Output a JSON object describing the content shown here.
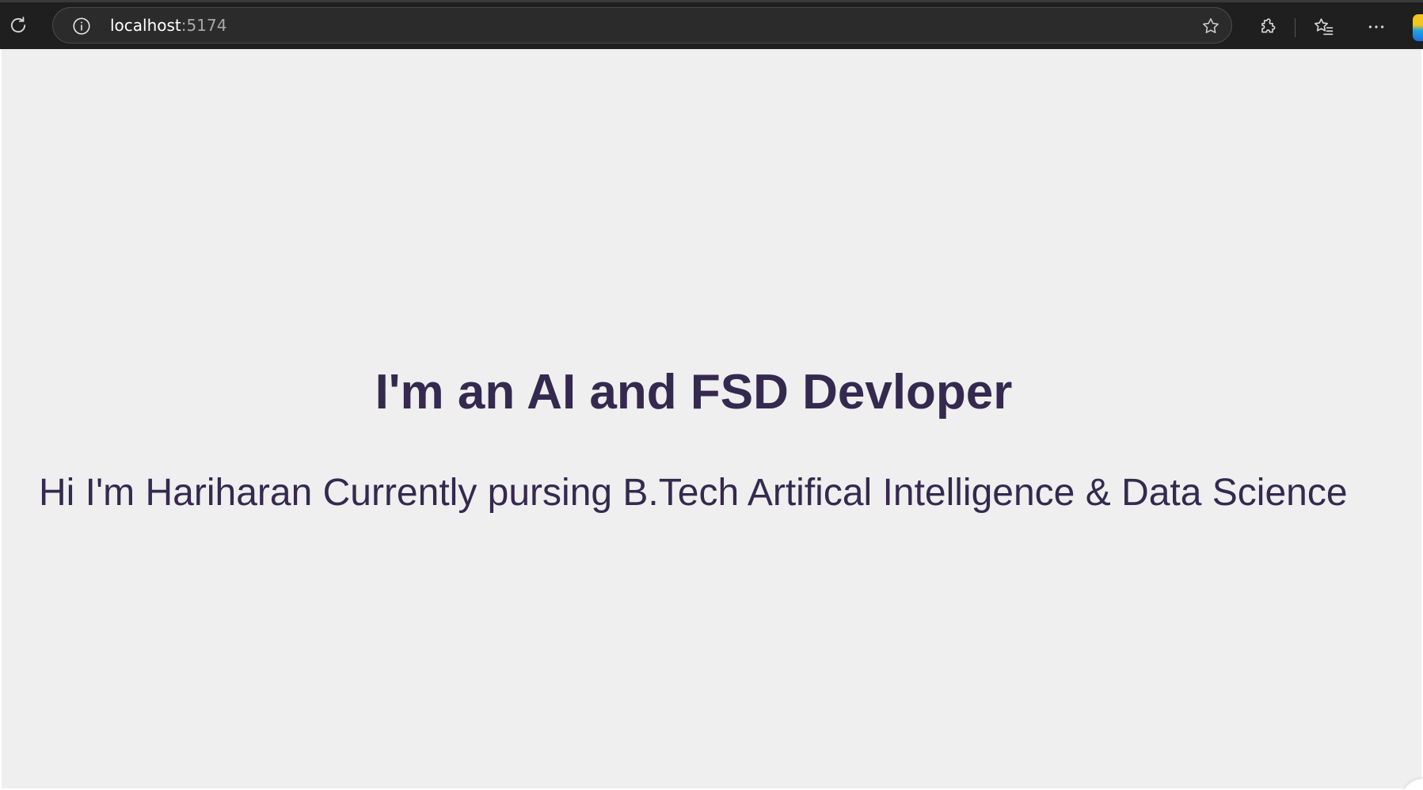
{
  "browser": {
    "url_host": "localhost",
    "url_port": ":5174",
    "icons": {
      "reload": "reload-icon",
      "site_info": "info-icon",
      "favorite": "star-icon",
      "extensions": "puzzle-icon",
      "favorites": "favorites-icon",
      "more": "more-icon"
    },
    "colors": {
      "toolbar": "#1f1f1f",
      "address_bar": "#2b2b2b"
    }
  },
  "page": {
    "title": "I'm an AI and FSD Devloper",
    "intro": "Hi I'm Hariharan Currently pursing B.Tech Artifical Intelligence & Data Science",
    "colors": {
      "background": "#efefef",
      "text": "#342a4f"
    }
  }
}
